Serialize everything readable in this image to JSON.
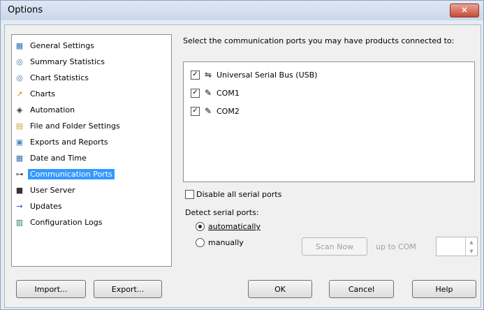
{
  "window": {
    "title": "Options",
    "close_label": "×"
  },
  "tree": {
    "items": [
      {
        "label": "General Settings",
        "icon": "general-settings-icon",
        "glyph": "▦",
        "color": "#2a6fb5"
      },
      {
        "label": "Summary Statistics",
        "icon": "summary-statistics-icon",
        "glyph": "◎",
        "color": "#4a6f9e"
      },
      {
        "label": "Chart Statistics",
        "icon": "chart-statistics-icon",
        "glyph": "◎",
        "color": "#4a6f9e"
      },
      {
        "label": "Charts",
        "icon": "charts-icon",
        "glyph": "↗",
        "color": "#d08a00"
      },
      {
        "label": "Automation",
        "icon": "automation-icon",
        "glyph": "◈",
        "color": "#333333"
      },
      {
        "label": "File and Folder Settings",
        "icon": "folder-icon",
        "glyph": "▤",
        "color": "#c9a43a"
      },
      {
        "label": "Exports and Reports",
        "icon": "exports-icon",
        "glyph": "▣",
        "color": "#4a88c7"
      },
      {
        "label": "Date and Time",
        "icon": "date-time-icon",
        "glyph": "▦",
        "color": "#3b6fb0"
      },
      {
        "label": "Communication Ports",
        "icon": "communication-ports-icon",
        "glyph": "⊶",
        "color": "#444444",
        "selected": true
      },
      {
        "label": "User Server",
        "icon": "user-server-icon",
        "glyph": "■",
        "color": "#333333"
      },
      {
        "label": "Updates",
        "icon": "updates-icon",
        "glyph": "→",
        "color": "#1f4fa5"
      },
      {
        "label": "Configuration Logs",
        "icon": "configuration-logs-icon",
        "glyph": "▥",
        "color": "#2a7a4a"
      }
    ]
  },
  "ports": {
    "instruction": "Select the communication ports you may have products connected to:",
    "items": [
      {
        "label": "Universal Serial Bus (USB)",
        "checked": true,
        "icon": "usb-icon",
        "glyph": "⇋"
      },
      {
        "label": "COM1",
        "checked": true,
        "icon": "serial-port-icon",
        "glyph": "✎"
      },
      {
        "label": "COM2",
        "checked": true,
        "icon": "serial-port-icon",
        "glyph": "✎"
      }
    ],
    "disable_serial_label": "Disable all serial ports",
    "disable_serial_checked": false,
    "detect_label": "Detect serial ports:",
    "radio_auto": "automatically",
    "radio_manual": "manually",
    "detect_mode": "automatically",
    "scan_now": "Scan Now",
    "up_to_com": "up to COM",
    "up_to_value": ""
  },
  "buttons": {
    "import": "Import...",
    "export": "Export...",
    "ok": "OK",
    "cancel": "Cancel",
    "help": "Help"
  }
}
